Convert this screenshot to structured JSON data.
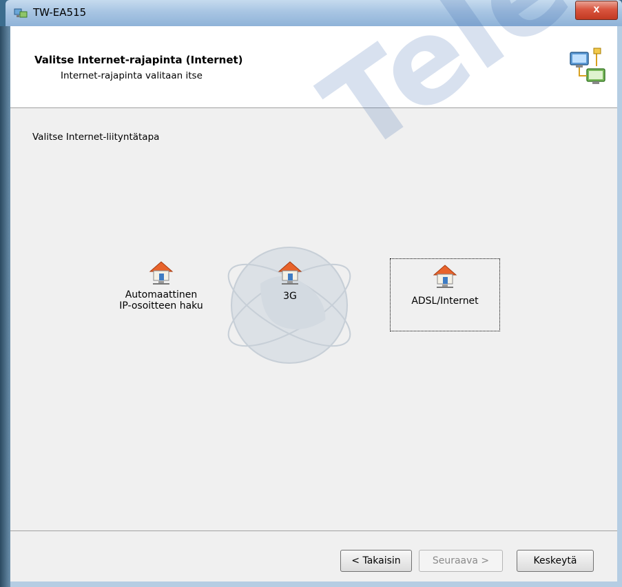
{
  "window": {
    "title": "TW-EA515",
    "close_glyph": "x"
  },
  "header": {
    "title": "Valitse Internet-rajapinta (Internet)",
    "subtitle": "Internet-rajapinta valitaan itse",
    "icon": "network-computers-icon"
  },
  "main": {
    "prompt": "Valitse Internet-liityntätapa",
    "watermark": "Telewell",
    "options": [
      {
        "label_line1": "Automaattinen",
        "label_line2": "IP-osoitteen haku",
        "icon": "house-network-icon",
        "selected": false
      },
      {
        "label_line1": "3G",
        "label_line2": "",
        "icon": "house-network-icon",
        "selected": false
      },
      {
        "label_line1": "ADSL/Internet",
        "label_line2": "",
        "icon": "house-network-icon",
        "selected": true
      }
    ]
  },
  "footer": {
    "back_label": "< Takaisin",
    "next_label": "Seuraava >",
    "cancel_label": "Keskeytä"
  },
  "colors": {
    "titlebar": "#a8c5e3",
    "close": "#c23a22",
    "client_bg": "#f0f0f0",
    "house_roof": "#e8632b"
  }
}
